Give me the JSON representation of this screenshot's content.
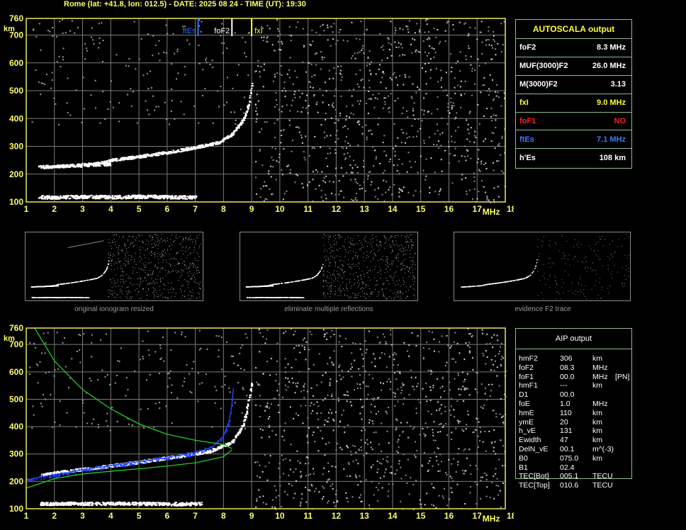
{
  "header": {
    "title": "Rome (lat: +41.8, lon: 012.5) - DATE: 2025 08 24 - TIME (UT): 19:30"
  },
  "chart_data": [
    {
      "type": "scatter",
      "name": "ionogram-top",
      "xlabel": "MHz",
      "ylabel": "km",
      "xlim": [
        1,
        18
      ],
      "ylim": [
        100,
        760
      ],
      "x_ticks": [
        1,
        2,
        3,
        4,
        5,
        6,
        7,
        8,
        9,
        10,
        11,
        12,
        13,
        14,
        15,
        16,
        17,
        18
      ],
      "y_ticks": [
        100,
        200,
        300,
        400,
        500,
        600,
        700,
        760
      ],
      "grid": true,
      "markers": [
        {
          "label": "ftEs",
          "x": 7.1,
          "color": "#2f6fff"
        },
        {
          "label": "foF2",
          "x": 8.3,
          "color": "#ffffff"
        },
        {
          "label": "fxI",
          "x": 9.0,
          "color": "#ffff33"
        }
      ],
      "traces": [
        {
          "kind": "Es-layer",
          "points": [
            [
              1.4,
              120
            ],
            [
              2,
              118
            ],
            [
              3,
              121
            ],
            [
              4,
              119
            ],
            [
              5,
              121
            ],
            [
              6,
              120
            ],
            [
              7,
              118
            ]
          ]
        },
        {
          "kind": "F-trace",
          "points": [
            [
              1.5,
              226
            ],
            [
              2.5,
              232
            ],
            [
              3.5,
              240
            ],
            [
              4,
              252
            ],
            [
              5,
              265
            ],
            [
              6,
              280
            ],
            [
              7,
              298
            ],
            [
              7.8,
              315
            ],
            [
              8.3,
              345
            ],
            [
              8.7,
              400
            ],
            [
              8.9,
              460
            ],
            [
              9.0,
              530
            ]
          ]
        },
        {
          "kind": "second-branch",
          "points": [
            [
              1.4,
              228
            ],
            [
              2,
              230
            ],
            [
              3,
              233
            ],
            [
              4,
              238
            ]
          ]
        }
      ]
    },
    {
      "type": "scatter",
      "name": "ionogram-bottom",
      "xlabel": "MHz",
      "ylabel": "km",
      "xlim": [
        1,
        18
      ],
      "ylim": [
        100,
        760
      ],
      "x_ticks": [
        1,
        2,
        3,
        4,
        5,
        6,
        7,
        8,
        9,
        10,
        11,
        12,
        13,
        14,
        15,
        16,
        17,
        18
      ],
      "y_ticks": [
        100,
        200,
        300,
        400,
        500,
        600,
        700,
        760
      ],
      "grid": true,
      "traces": [
        {
          "kind": "Es-layer",
          "points": [
            [
              1.5,
              120
            ],
            [
              2.5,
              121
            ],
            [
              3.5,
              120
            ],
            [
              4.5,
              122
            ],
            [
              5.5,
              120
            ],
            [
              6.5,
              119
            ],
            [
              7.2,
              120
            ]
          ]
        },
        {
          "kind": "F-trace",
          "points": [
            [
              1.5,
              225
            ],
            [
              2.5,
              240
            ],
            [
              3.5,
              252
            ],
            [
              4.5,
              265
            ],
            [
              5.5,
              280
            ],
            [
              6.5,
              295
            ],
            [
              7.5,
              312
            ],
            [
              8.3,
              345
            ],
            [
              8.7,
              410
            ],
            [
              9.0,
              560
            ]
          ]
        },
        {
          "kind": "blue-fit",
          "color": "#3050ff",
          "points": [
            [
              1.0,
              205
            ],
            [
              2,
              225
            ],
            [
              3,
              242
            ],
            [
              4,
              258
            ],
            [
              5,
              272
            ],
            [
              6,
              287
            ],
            [
              7,
              305
            ],
            [
              7.6,
              325
            ],
            [
              8.0,
              365
            ],
            [
              8.2,
              420
            ],
            [
              8.3,
              480
            ],
            [
              8.35,
              540
            ]
          ]
        },
        {
          "kind": "green-profile-upper",
          "color": "#22cc22",
          "points": [
            [
              1.3,
              760
            ],
            [
              2,
              640
            ],
            [
              3,
              535
            ],
            [
              4,
              465
            ],
            [
              5,
              410
            ],
            [
              6,
              372
            ],
            [
              7,
              350
            ],
            [
              8,
              335
            ],
            [
              8.3,
              320
            ]
          ]
        },
        {
          "kind": "green-profile-lower",
          "color": "#22cc22",
          "points": [
            [
              1.0,
              175
            ],
            [
              2,
              210
            ],
            [
              3,
              227
            ],
            [
              4,
              237
            ],
            [
              5,
              246
            ],
            [
              6,
              256
            ],
            [
              7,
              268
            ],
            [
              8,
              290
            ],
            [
              8.3,
              315
            ]
          ]
        }
      ]
    }
  ],
  "autoscala": {
    "title": "AUTOSCALA output",
    "rows": [
      {
        "label": "foF2",
        "value": "8.3 MHz",
        "color": "#ffffff"
      },
      {
        "label": "MUF(3000)F2",
        "value": "26.0 MHz",
        "color": "#ffffff"
      },
      {
        "label": "M(3000)F2",
        "value": "3.13",
        "color": "#ffffff"
      },
      {
        "label": "fxI",
        "value": "9.0 MHz",
        "color": "#ffff33"
      },
      {
        "label": "foF1",
        "value": "NO",
        "color": "#ff2020"
      },
      {
        "label": "ftEs",
        "value": "7.1 MHz",
        "color": "#3a7bff"
      },
      {
        "label": "h'Es",
        "value": "108 km",
        "color": "#ffffff"
      }
    ]
  },
  "thumbnails": [
    {
      "caption": "original ionogram resized"
    },
    {
      "caption": "eliminate multiple reflections"
    },
    {
      "caption": "evidence F2 trace"
    }
  ],
  "aip": {
    "title": "AIP output",
    "rows": [
      {
        "label": "hmF2",
        "value": "306",
        "unit": "km",
        "extra": ""
      },
      {
        "label": "foF2",
        "value": "08.3",
        "unit": "MHz",
        "extra": ""
      },
      {
        "label": "foF1",
        "value": "00.0",
        "unit": "MHz",
        "extra": "[PN]"
      },
      {
        "label": "hmF1",
        "value": "---",
        "unit": "km",
        "extra": ""
      },
      {
        "label": "D1",
        "value": "00.0",
        "unit": "",
        "extra": ""
      },
      {
        "label": "foE",
        "value": "1.0",
        "unit": "MHz",
        "extra": ""
      },
      {
        "label": "hmE",
        "value": "110",
        "unit": "km",
        "extra": ""
      },
      {
        "label": "ymE",
        "value": "20",
        "unit": "km",
        "extra": ""
      },
      {
        "label": "h_vE",
        "value": "131",
        "unit": "km",
        "extra": ""
      },
      {
        "label": "Ewidth",
        "value": "47",
        "unit": "km",
        "extra": ""
      },
      {
        "label": "DelN_vE",
        "value": "00.1",
        "unit": "m^(-3)",
        "extra": ""
      },
      {
        "label": "B0",
        "value": "075.0",
        "unit": "km",
        "extra": ""
      },
      {
        "label": "B1",
        "value": "02.4",
        "unit": "",
        "extra": ""
      },
      {
        "label": "TEC[Bot]",
        "value": "005.1",
        "unit": "TECU",
        "extra": ""
      },
      {
        "label": "TEC[Top]",
        "value": "010.6",
        "unit": "TECU",
        "extra": ""
      }
    ]
  }
}
